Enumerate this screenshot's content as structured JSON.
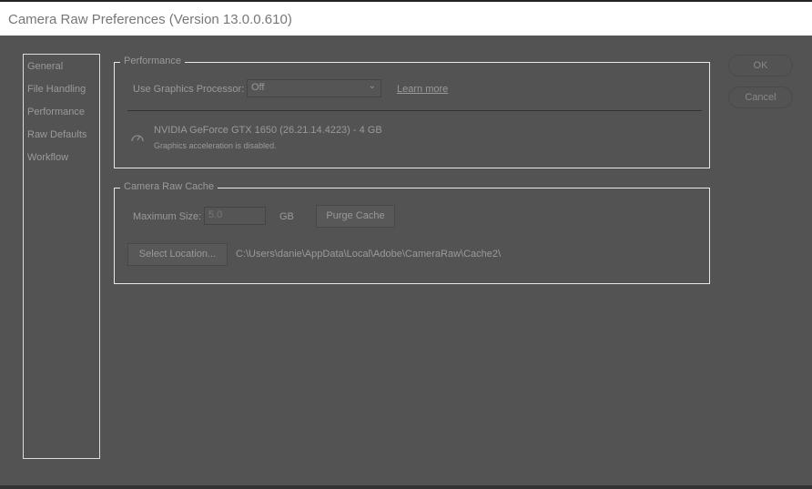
{
  "window": {
    "title": "Camera Raw Preferences  (Version 13.0.0.610)"
  },
  "nav": {
    "items": [
      "General",
      "File Handling",
      "Performance",
      "Raw Defaults",
      "Workflow"
    ]
  },
  "performance": {
    "legend": "Performance",
    "gpu_label": "Use Graphics Processor:",
    "gpu_value": "Off",
    "learn_more": "Learn more",
    "gpu_name": "NVIDIA GeForce GTX 1650 (26.21.14.4223) - 4 GB",
    "gpu_status": "Graphics acceleration is disabled.",
    "icon": "gauge-icon"
  },
  "cache": {
    "legend": "Camera Raw Cache",
    "max_label": "Maximum Size:",
    "max_value": "5.0",
    "unit": "GB",
    "purge": "Purge Cache",
    "select_location": "Select Location...",
    "path": "C:\\Users\\danie\\AppData\\Local\\Adobe\\CameraRaw\\Cache2\\"
  },
  "buttons": {
    "ok": "OK",
    "cancel": "Cancel"
  }
}
